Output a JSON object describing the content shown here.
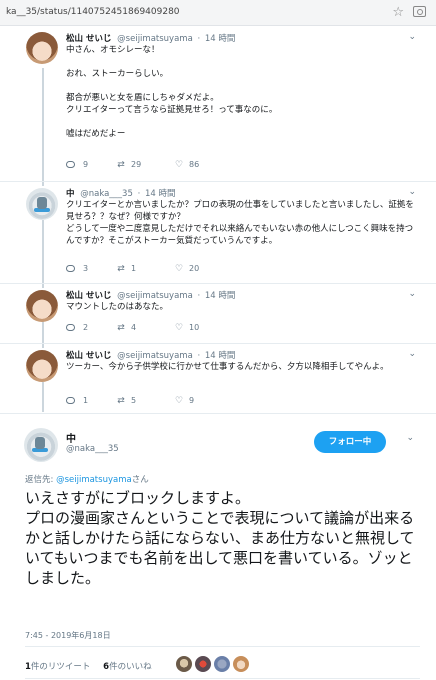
{
  "browser": {
    "url": "ka__35/status/1140752451869409280"
  },
  "thread": [
    {
      "name": "松山 せいじ",
      "handle": "@seijimatsuyama",
      "time": "14 時間",
      "text": "中さん、オモシレーな！\n\nおれ、ストーカーらしい。\n\n都合が悪いと女を盾にしちゃダメだよ。\nクリエイターって言うなら証拠見せろ！って事なのに。\n\n嘘はだめだよー",
      "replies": "9",
      "retweets": "29",
      "likes": "86"
    },
    {
      "name": "中",
      "handle": "@naka___35",
      "time": "14 時間",
      "text": "クリエイターとか言いましたか？プロの表現の仕事をしていましたと言いましたし、証拠を見せろ？？なぜ？何様ですか？\nどうして一度や二度意見しただけでそれ以来絡んでもいない赤の他人にしつこく興味を持つんですか？そこがストーカー気質だっていうんですよ。",
      "replies": "3",
      "retweets": "1",
      "likes": "20"
    },
    {
      "name": "松山 せいじ",
      "handle": "@seijimatsuyama",
      "time": "14 時間",
      "text": "マウントしたのはあなた。",
      "replies": "2",
      "retweets": "4",
      "likes": "10"
    },
    {
      "name": "松山 せいじ",
      "handle": "@seijimatsuyama",
      "time": "14 時間",
      "text": "ツーカー、今から子供学校に行かせて仕事するんだから、夕方以降相手してやんよ。",
      "replies": "1",
      "retweets": "5",
      "likes": "9"
    }
  ],
  "main": {
    "name": "中",
    "handle": "@naka___35",
    "follow_label": "フォロー中",
    "reply_prefix": "返信先: ",
    "reply_handle": "@seijimatsuyama",
    "reply_suffix": "さん",
    "text": "いえさすがにブロックしますよ。\nプロの漫画家さんということで表現について議論が出来るかと話しかけたら話にならない、まあ仕方ないと無視していてもいつまでも名前を出して悪口を書いている。ゾッとしました。",
    "timestamp": "7:45 - 2019年6月18日",
    "retweet_count": "1",
    "retweet_label": "件のリツイート",
    "like_count": "6",
    "like_label": "件のいいね"
  },
  "icons": {
    "reply": "reply-icon",
    "retweet": "retweet-icon",
    "like": "heart-icon",
    "menu": "chevron-down-icon"
  },
  "colors": {
    "accent": "#1da1f2",
    "link": "#1b95e0",
    "muted": "#657786"
  }
}
